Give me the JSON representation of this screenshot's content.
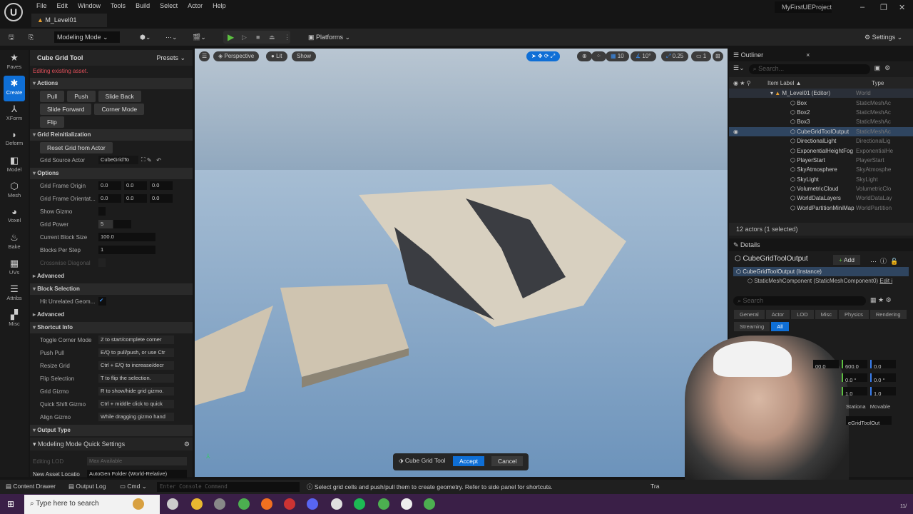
{
  "app": {
    "logo": "U",
    "menu": [
      "File",
      "Edit",
      "Window",
      "Tools",
      "Build",
      "Select",
      "Actor",
      "Help"
    ],
    "level_tab": "M_Level01",
    "project": "MyFirstUEProject"
  },
  "toolbar": {
    "mode": "Modeling Mode",
    "platforms": "Platforms",
    "settings": "Settings"
  },
  "modes": [
    {
      "label": "Faves",
      "icon": "★"
    },
    {
      "label": "Create",
      "icon": "✱",
      "active": true
    },
    {
      "label": "XForm",
      "icon": "⅄"
    },
    {
      "label": "Deform",
      "icon": "◗"
    },
    {
      "label": "Model",
      "icon": "◧"
    },
    {
      "label": "Mesh",
      "icon": "⬡"
    },
    {
      "label": "Voxel",
      "icon": "◕"
    },
    {
      "label": "Bake",
      "icon": "♨"
    },
    {
      "label": "UVs",
      "icon": "▦"
    },
    {
      "label": "Attribs",
      "icon": "☰"
    },
    {
      "label": "Misc",
      "icon": "▞"
    }
  ],
  "tool_panel": {
    "title": "Cube Grid Tool",
    "presets": "Presets",
    "warning": "Editing existing asset.",
    "actions": {
      "title": "Actions",
      "buttons": [
        "Pull",
        "Push",
        "Slide Back",
        "Slide Forward",
        "Corner Mode",
        "Flip"
      ]
    },
    "grid_reinit": {
      "title": "Grid Reinitialization",
      "reset": "Reset Grid from Actor",
      "source_label": "Grid Source Actor",
      "source_value": "CubeGridTo"
    },
    "options": {
      "title": "Options",
      "frame_origin": {
        "label": "Grid Frame Origin",
        "values": [
          "0.0",
          "0.0",
          "0.0"
        ]
      },
      "frame_orient": {
        "label": "Grid Frame Orientat...",
        "values": [
          "0.0",
          "0.0",
          "0.0"
        ]
      },
      "show_gizmo": "Show Gizmo",
      "grid_power": {
        "label": "Grid Power",
        "value": "5"
      },
      "block_size": {
        "label": "Current Block Size",
        "value": "100.0"
      },
      "blocks_per_step": {
        "label": "Blocks Per Step",
        "value": "1"
      },
      "crosswise": "Crosswise Diagonal",
      "advanced": "Advanced"
    },
    "block_selection": {
      "title": "Block Selection",
      "hit_label": "Hit Unrelated Geom...",
      "hit_checked": true,
      "advanced": "Advanced"
    },
    "shortcuts": {
      "title": "Shortcut Info",
      "items": [
        {
          "label": "Toggle Corner Mode",
          "value": "Z to start/complete corner"
        },
        {
          "label": "Push Pull",
          "value": "E/Q to pull/push, or use Ctr"
        },
        {
          "label": "Resize Grid",
          "value": "Ctrl + E/Q to increase/decr"
        },
        {
          "label": "Flip Selection",
          "value": "T to flip the selection."
        },
        {
          "label": "Grid Gizmo",
          "value": "R to show/hide grid gizmo."
        },
        {
          "label": "Quick Shift Gizmo",
          "value": "Ctrl + middle click to quick"
        },
        {
          "label": "Align Gizmo",
          "value": "While dragging gizmo hand"
        }
      ]
    },
    "output_type": "Output Type",
    "quick": {
      "title": "Modeling Mode Quick Settings",
      "lod_label": "Editing LOD",
      "lod_value": "Max Available",
      "loc_label": "New Asset Locatio",
      "loc_value": "AutoGen Folder (World-Relative)"
    }
  },
  "viewport": {
    "perspective": "Perspective",
    "lit": "Lit",
    "show": "Show",
    "grid_snap": "10",
    "rot_snap": "10°",
    "scale_snap": "0.25",
    "camera": "1",
    "tool_name": "Cube Grid Tool",
    "accept": "Accept",
    "cancel": "Cancel"
  },
  "outliner": {
    "title": "Outliner",
    "search_placeholder": "Search...",
    "col_label": "Item Label ▲",
    "col_type": "Type",
    "world": {
      "name": "M_Level01 (Editor)",
      "type": "World"
    },
    "items": [
      {
        "name": "Box",
        "type": "StaticMeshAc"
      },
      {
        "name": "Box2",
        "type": "StaticMeshAc"
      },
      {
        "name": "Box3",
        "type": "StaticMeshAc"
      },
      {
        "name": "CubeGridToolOutput",
        "type": "StaticMeshAc",
        "selected": true
      },
      {
        "name": "DirectionalLight",
        "type": "DirectionalLig"
      },
      {
        "name": "ExponentialHeightFog",
        "type": "ExponentialHe"
      },
      {
        "name": "PlayerStart",
        "type": "PlayerStart"
      },
      {
        "name": "SkyAtmosphere",
        "type": "SkyAtmosphe"
      },
      {
        "name": "SkyLight",
        "type": "SkyLight"
      },
      {
        "name": "VolumetricCloud",
        "type": "VolumetricClo"
      },
      {
        "name": "WorldDataLayers",
        "type": "WorldDataLay"
      },
      {
        "name": "WorldPartitionMiniMap",
        "type": "WorldPartition"
      }
    ],
    "count": "12 actors (1 selected)"
  },
  "details": {
    "title": "Details",
    "actor": "CubeGridToolOutput",
    "add": "Add",
    "instance": "CubeGridToolOutput (Instance)",
    "component": "StaticMeshComponent (StaticMeshComponent0)",
    "edit": "Edit i",
    "search_placeholder": "Search",
    "tabs": [
      "General",
      "Actor",
      "LOD",
      "Misc",
      "Physics",
      "Rendering",
      "Streaming",
      "All"
    ],
    "loc": [
      "00.0",
      "600.0",
      "0.0"
    ],
    "rot": [
      "0.0 °",
      "0.0 °"
    ],
    "scale": [
      "1.0",
      "1.0"
    ],
    "mobility": [
      "Stationa",
      "Movable"
    ],
    "mesh": "eGridToolOut"
  },
  "statusbar": {
    "content_drawer": "Content Drawer",
    "output_log": "Output Log",
    "cmd": "Cmd",
    "console_placeholder": "Enter Console Command",
    "hint": "Select grid cells and push/pull them to create geometry. Refer to side panel for shortcuts.",
    "trace": "Tra"
  },
  "taskbar": {
    "search_placeholder": "Type here to search",
    "time": "11/"
  },
  "colors": {
    "accent": "#0f6fd6",
    "warning": "#e0505a",
    "taskbar": "#3a1f47"
  }
}
